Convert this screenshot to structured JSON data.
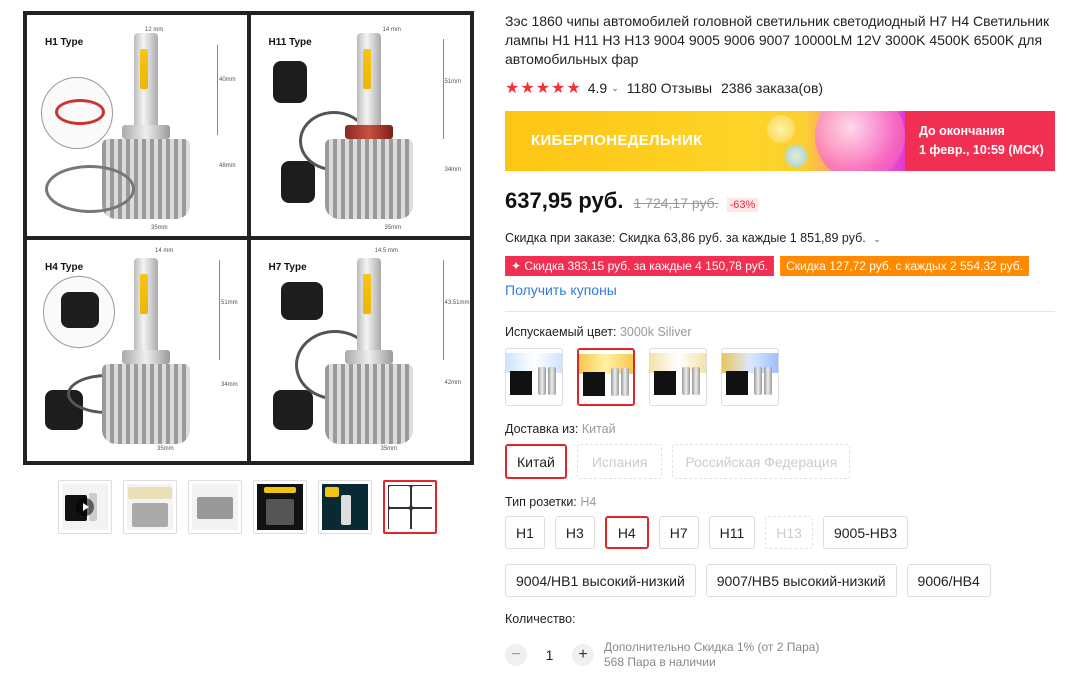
{
  "gallery": {
    "quadrants": [
      {
        "label": "H1 Type",
        "dim_top": "12 mm",
        "dim_mid": "40mm",
        "dim_low": "48mm",
        "dim_bottom": "35mm"
      },
      {
        "label": "H11 Type",
        "dim_top": "14 mm",
        "dim_mid": "51mm",
        "dim_low": "34mm",
        "dim_bottom": "35mm"
      },
      {
        "label": "H4 Type",
        "dim_top": "14 mm",
        "dim_mid": "51mm",
        "dim_low": "34mm",
        "dim_bottom": "35mm"
      },
      {
        "label": "H7 Type",
        "dim_top": "14.5 mm",
        "dim_mid": "43.51mm",
        "dim_low": "42mm",
        "dim_bottom": "35mm"
      }
    ]
  },
  "product": {
    "title": "Зэс 1860 чипы автомобилей головной светильник светодиодный H7 H4 Светильник лампы H1 H11 H3 H13 9004 9005 9006 9007 10000LM 12V 3000K 4500K 6500K для автомобильных фар",
    "rating": "4.9",
    "reviews": "1180 Отзывы",
    "orders": "2386 заказа(ов)",
    "stars": "★★★★★"
  },
  "banner": {
    "label": "КИБЕРПОНЕДЕЛЬНИК",
    "countdown_line1": "До окончания",
    "countdown_line2": "1 февр., 10:59 (МСК)"
  },
  "price": {
    "current": "637,95 руб.",
    "old": "1 724,17 руб.",
    "discount": "-63%"
  },
  "order_discount": "Скидка при заказе: Скидка 63,86 руб. за каждые 1 851,89 руб.",
  "coupons": [
    "✦ Скидка 383,15 руб. за каждые 4 150,78 руб.",
    "Скидка 127,72 руб. с каждых 2 554,32 руб."
  ],
  "get_coupons": "Получить купоны",
  "color": {
    "label": "Испускаемый цвет:",
    "selected": "3000k Siliver"
  },
  "shipping": {
    "label": "Доставка из:",
    "selected": "Китай",
    "options": [
      "Китай",
      "Испания",
      "Российская Федерация"
    ]
  },
  "socket": {
    "label": "Тип розетки:",
    "selected": "H4",
    "row1": [
      "H1",
      "H3",
      "H4",
      "H7",
      "H11",
      "H13",
      "9005-HB3"
    ],
    "row2": [
      "9004/HB1 высокий-низкий",
      "9007/HB5 высокий-низкий",
      "9006/HB4"
    ]
  },
  "quantity": {
    "label": "Количество:",
    "value": "1",
    "minus": "−",
    "plus": "+",
    "note_line1": "Дополнительно Скидка 1% (от 2 Пара)",
    "note_line2": "568 Пара в наличии"
  },
  "colors": {
    "accent_red": "#e0262a",
    "banner_pink": "#f12f52",
    "banner_yellow": "#fec514",
    "coupon_orange": "#ff8a00",
    "link_blue": "#2f7ae3"
  }
}
